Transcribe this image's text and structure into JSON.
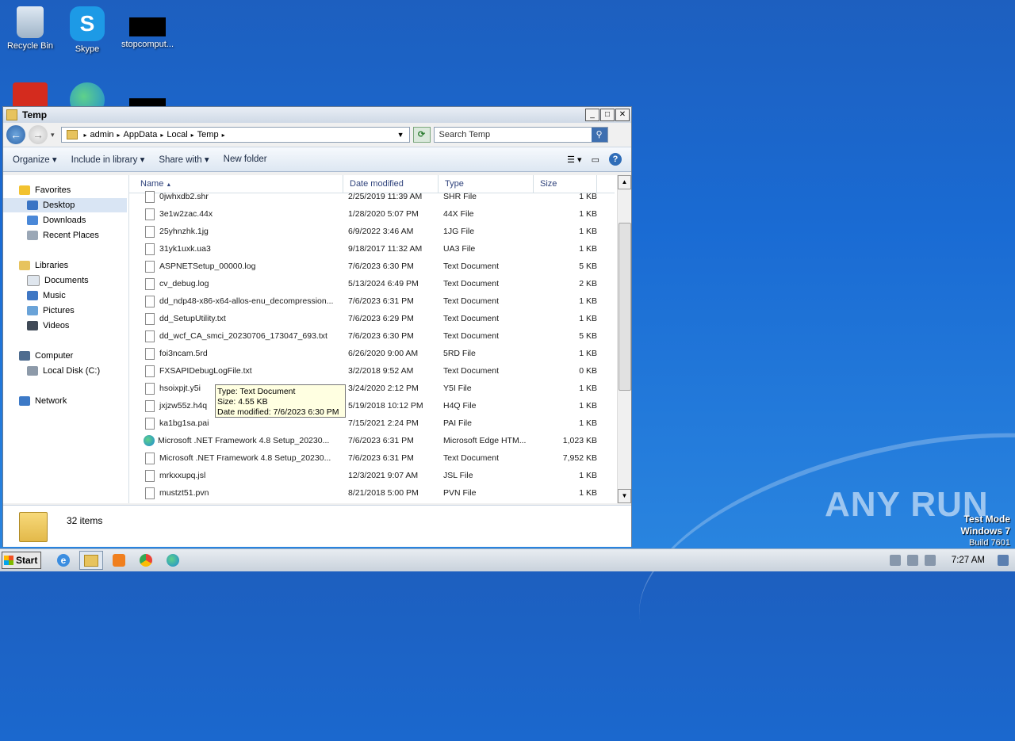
{
  "desktop": {
    "icons": [
      {
        "label": "Recycle Bin"
      },
      {
        "label": "Skype"
      },
      {
        "label": "stopcomput..."
      }
    ],
    "watermark": "ANY RUN",
    "test_mode": {
      "line1": "Test Mode",
      "line2": "Windows 7",
      "line3": "Build 7601"
    }
  },
  "window": {
    "title": "Temp",
    "breadcrumbs": [
      "admin",
      "AppData",
      "Local",
      "Temp"
    ],
    "search_placeholder": "Search Temp",
    "toolbar": {
      "organize": "Organize",
      "include_in_library": "Include in library",
      "share_with": "Share with",
      "new_folder": "New folder"
    },
    "nav": {
      "favorites": "Favorites",
      "desktop": "Desktop",
      "downloads": "Downloads",
      "recent_places": "Recent Places",
      "libraries": "Libraries",
      "documents": "Documents",
      "music": "Music",
      "pictures": "Pictures",
      "videos": "Videos",
      "computer": "Computer",
      "local_disk": "Local Disk (C:)",
      "network": "Network"
    },
    "columns": {
      "name": "Name",
      "date": "Date modified",
      "type": "Type",
      "size": "Size"
    },
    "files": [
      {
        "name": "0jwhxdb2.shr",
        "date": "2/25/2019 11:39 AM",
        "type": "SHR File",
        "size": "1 KB"
      },
      {
        "name": "3e1w2zac.44x",
        "date": "1/28/2020 5:07 PM",
        "type": "44X File",
        "size": "1 KB"
      },
      {
        "name": "25yhnzhk.1jg",
        "date": "6/9/2022 3:46 AM",
        "type": "1JG File",
        "size": "1 KB"
      },
      {
        "name": "31yk1uxk.ua3",
        "date": "9/18/2017 11:32 AM",
        "type": "UA3 File",
        "size": "1 KB"
      },
      {
        "name": "ASPNETSetup_00000.log",
        "date": "7/6/2023 6:30 PM",
        "type": "Text Document",
        "size": "5 KB"
      },
      {
        "name": "cv_debug.log",
        "date": "5/13/2024 6:49 PM",
        "type": "Text Document",
        "size": "2 KB"
      },
      {
        "name": "dd_ndp48-x86-x64-allos-enu_decompression...",
        "date": "7/6/2023 6:31 PM",
        "type": "Text Document",
        "size": "1 KB"
      },
      {
        "name": "dd_SetupUtility.txt",
        "date": "7/6/2023 6:29 PM",
        "type": "Text Document",
        "size": "1 KB"
      },
      {
        "name": "dd_wcf_CA_smci_20230706_173047_693.txt",
        "date": "7/6/2023 6:30 PM",
        "type": "Text Document",
        "size": "5 KB"
      },
      {
        "name": "foi3ncam.5rd",
        "date": "6/26/2020 9:00 AM",
        "type": "5RD File",
        "size": "1 KB"
      },
      {
        "name": "FXSAPIDebugLogFile.txt",
        "date": "3/2/2018 9:52 AM",
        "type": "Text Document",
        "size": "0 KB"
      },
      {
        "name": "hsoixpjt.y5i",
        "date": "3/24/2020 2:12 PM",
        "type": "Y5I File",
        "size": "1 KB"
      },
      {
        "name": "jxjzw55z.h4q",
        "date": "5/19/2018 10:12 PM",
        "type": "H4Q File",
        "size": "1 KB"
      },
      {
        "name": "ka1bg1sa.pai",
        "date": "7/15/2021 2:24 PM",
        "type": "PAI File",
        "size": "1 KB"
      },
      {
        "name": "Microsoft .NET Framework 4.8 Setup_20230...",
        "date": "7/6/2023 6:31 PM",
        "type": "Microsoft Edge HTM...",
        "size": "1,023 KB",
        "icon": "edge-icon"
      },
      {
        "name": "Microsoft .NET Framework 4.8 Setup_20230...",
        "date": "7/6/2023 6:31 PM",
        "type": "Text Document",
        "size": "7,952 KB"
      },
      {
        "name": "mrkxxupq.jsl",
        "date": "12/3/2021 9:07 AM",
        "type": "JSL File",
        "size": "1 KB"
      },
      {
        "name": "mustzt51.pvn",
        "date": "8/21/2018 5:00 PM",
        "type": "PVN File",
        "size": "1 KB"
      }
    ],
    "tooltip": {
      "type": "Type: Text Document",
      "size": "Size: 4.55 KB",
      "date": "Date modified: 7/6/2023 6:30 PM"
    },
    "status": {
      "count": "32 items"
    }
  },
  "taskbar": {
    "start": "Start",
    "clock": "7:27 AM"
  }
}
